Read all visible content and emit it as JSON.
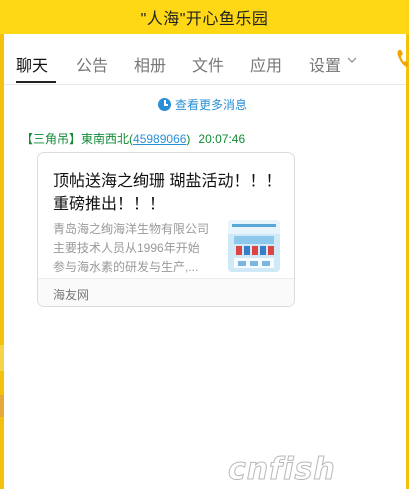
{
  "window": {
    "title": "\"人海\"开心鱼乐园"
  },
  "tabs": [
    {
      "label": "聊天",
      "active": true
    },
    {
      "label": "公告"
    },
    {
      "label": "相册"
    },
    {
      "label": "文件"
    },
    {
      "label": "应用"
    },
    {
      "label": "设置"
    }
  ],
  "chat": {
    "load_more": "查看更多消息",
    "sender": {
      "tag": "【三角吊】",
      "name": "東南西北",
      "qq_open": "(",
      "qq": "45989066",
      "qq_close": ")",
      "time": "20:07:46"
    },
    "card": {
      "title": "顶帖送海之绚珊 瑚盐活动！！！ 重磅推出！！！",
      "desc_lines": [
        "青岛海之绚海洋生物有限公司",
        "主要技术人员从1996年开始",
        "参与海水素的研发与生产,..."
      ],
      "source": "海友网"
    }
  },
  "watermark": "cnfish",
  "colors": {
    "title_bar": "#ffd815",
    "link": "#2b8fd6",
    "sender": "#118a36"
  }
}
